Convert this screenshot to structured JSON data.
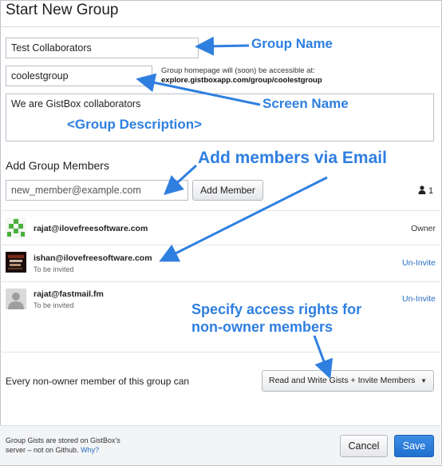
{
  "dialog": {
    "title": "Start New Group"
  },
  "form": {
    "group_name_value": "Test Collaborators",
    "screen_name_value": "coolestgroup",
    "homepage_hint_line1": "Group homepage will (soon) be accessible at:",
    "homepage_hint_url": "explore.gistboxapp.com/group/coolestgroup",
    "description_value": "We are GistBox collaborators"
  },
  "members_section": {
    "title": "Add Group Members",
    "email_placeholder": "new_member@example.com",
    "add_button_label": "Add Member",
    "member_count": "1"
  },
  "members": [
    {
      "email": "rajat@ilovefreesoftware.com",
      "status": "",
      "action": "Owner"
    },
    {
      "email": "ishan@ilovefreesoftware.com",
      "status": "To be invited",
      "action": "Un-Invite"
    },
    {
      "email": "rajat@fastmail.fm",
      "status": "To be invited",
      "action": "Un-Invite"
    }
  ],
  "access": {
    "label": "Every non-owner member of this group can",
    "selected_option": "Read and Write Gists + Invite Members"
  },
  "footer": {
    "note_line1": "Group Gists are stored on GistBox's",
    "note_line2": "server – not on Github.",
    "note_link": "Why?",
    "cancel_label": "Cancel",
    "save_label": "Save"
  },
  "annotations": {
    "group_name": "Group Name",
    "screen_name": "Screen Name",
    "group_description": "<Group Description>",
    "add_members": "Add members via Email",
    "access_rights_line1": "Specify access rights for",
    "access_rights_line2": "non-owner members"
  },
  "colors": {
    "accent": "#2f7fe0",
    "link": "#2a6bc4",
    "primary_button": "#1f6fcf"
  },
  "icons": {
    "member_count": "person-icon",
    "select_caret": "caret-down-icon"
  }
}
